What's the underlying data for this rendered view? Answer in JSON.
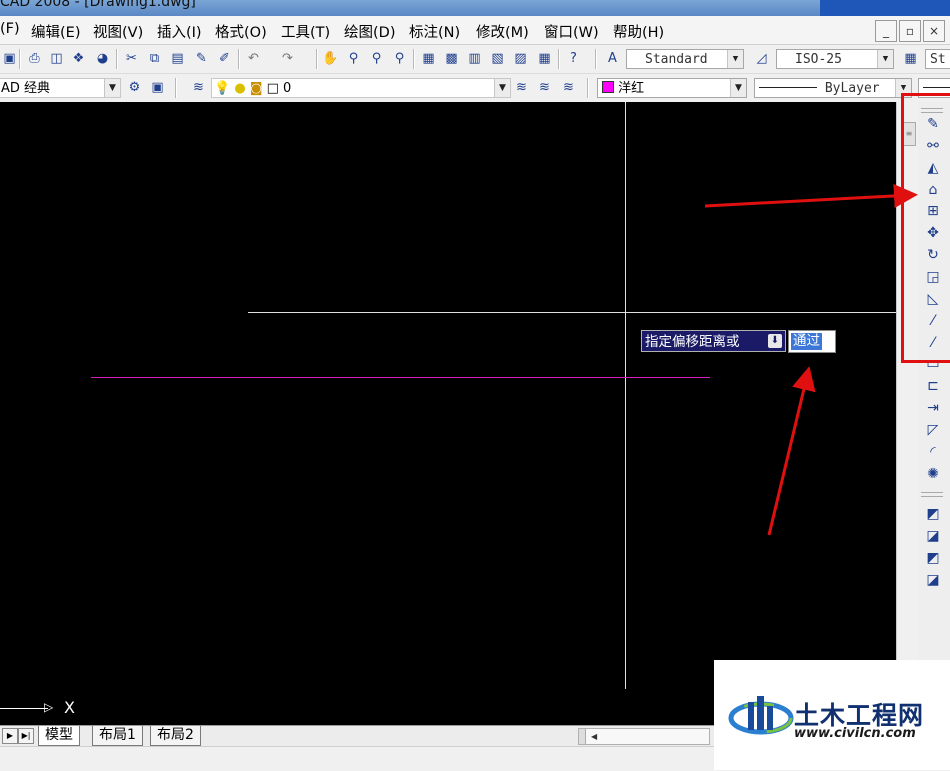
{
  "window": {
    "title": "CAD 2008 - [Drawing1.dwg]"
  },
  "menubar": {
    "items": [
      "(F)",
      "编辑(E)",
      "视图(V)",
      "插入(I)",
      "格式(O)",
      "工具(T)",
      "绘图(D)",
      "标注(N)",
      "修改(M)",
      "窗口(W)",
      "帮助(H)"
    ],
    "controls": [
      "_",
      "▫",
      "×"
    ]
  },
  "toolbar1": {
    "text_style": "Standard",
    "dim_style": "ISO-25",
    "table_style_partial": "St"
  },
  "toolbar2": {
    "workspace": "AD 经典",
    "layer": "0",
    "color": "洋红",
    "color_swatch": "#ff00ff",
    "linetype": "ByLayer"
  },
  "canvas": {
    "background": "#000000",
    "crosshair_color": "#e0e0e0",
    "magenta_line_color": "#d020c0",
    "prompt_text": "指定偏移距离或",
    "dynamic_input_value": "通过",
    "ucs_label": "X"
  },
  "layout_tabs": {
    "items": [
      "模型",
      "布局1",
      "布局2"
    ],
    "active": "模型"
  },
  "annotation": {
    "highlight_color": "#e01010"
  },
  "watermark": {
    "name": "土木工程网",
    "url": "www.civilcn.com"
  }
}
